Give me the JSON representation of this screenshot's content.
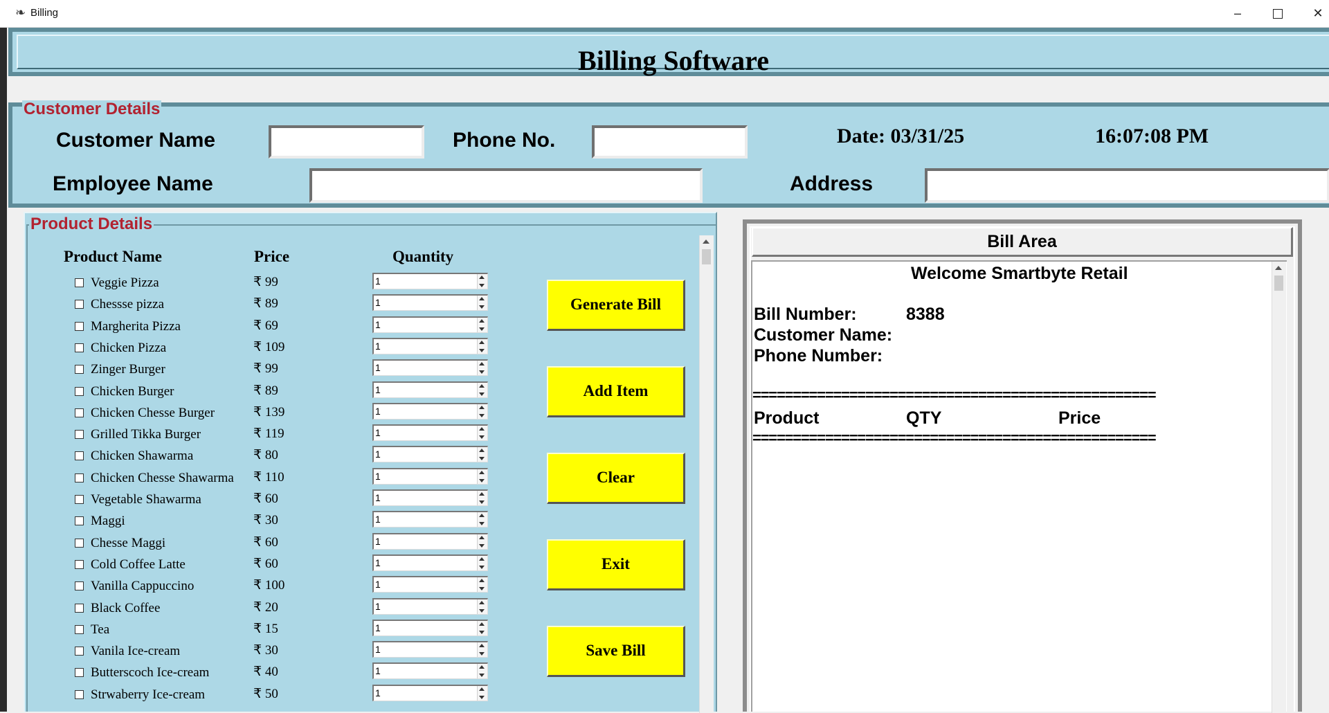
{
  "window": {
    "title": "Billing",
    "minimize_glyph": "–",
    "close_glyph": "✕"
  },
  "header": {
    "title": "Billing Software"
  },
  "customer": {
    "frame_label": "Customer Details",
    "name_label": "Customer Name",
    "name_value": "",
    "phone_label": "Phone No.",
    "phone_value": "",
    "date_label": "Date: 03/31/25",
    "time_label": "16:07:08 PM",
    "employee_label": "Employee Name",
    "employee_value": "",
    "address_label": "Address",
    "address_value": ""
  },
  "products": {
    "frame_label": "Product Details",
    "headers": {
      "name": "Product Name",
      "price": "Price",
      "quantity": "Quantity"
    },
    "items": [
      {
        "name": "Veggie Pizza",
        "price": "₹ 99",
        "qty": "1"
      },
      {
        "name": "Chessse pizza",
        "price": "₹ 89",
        "qty": "1"
      },
      {
        "name": "Margherita Pizza",
        "price": "₹ 69",
        "qty": "1"
      },
      {
        "name": "Chicken Pizza",
        "price": "₹ 109",
        "qty": "1"
      },
      {
        "name": "Zinger Burger",
        "price": "₹ 99",
        "qty": "1"
      },
      {
        "name": "Chicken Burger",
        "price": "₹ 89",
        "qty": "1"
      },
      {
        "name": "Chicken Chesse Burger",
        "price": "₹ 139",
        "qty": "1"
      },
      {
        "name": "Grilled Tikka Burger",
        "price": "₹ 119",
        "qty": "1"
      },
      {
        "name": "Chicken Shawarma",
        "price": "₹ 80",
        "qty": "1"
      },
      {
        "name": "Chicken Chesse Shawarma",
        "price": "₹ 110",
        "qty": "1"
      },
      {
        "name": "Vegetable Shawarma",
        "price": "₹ 60",
        "qty": "1"
      },
      {
        "name": "Maggi",
        "price": "₹ 30",
        "qty": "1"
      },
      {
        "name": "Chesse Maggi",
        "price": "₹ 60",
        "qty": "1"
      },
      {
        "name": "Cold Coffee Latte",
        "price": "₹ 60",
        "qty": "1"
      },
      {
        "name": "Vanilla Cappuccino",
        "price": "₹ 100",
        "qty": "1"
      },
      {
        "name": "Black Coffee",
        "price": "₹ 20",
        "qty": "1"
      },
      {
        "name": "Tea",
        "price": "₹ 15",
        "qty": "1"
      },
      {
        "name": "Vanila Ice-cream",
        "price": "₹ 30",
        "qty": "1"
      },
      {
        "name": "Butterscoch Ice-cream",
        "price": "₹ 40",
        "qty": "1"
      },
      {
        "name": "Strwaberry Ice-cream",
        "price": "₹ 50",
        "qty": "1"
      }
    ]
  },
  "buttons": {
    "generate": "Generate Bill",
    "add": "Add Item",
    "clear": "Clear",
    "exit": "Exit",
    "save": "Save Bill"
  },
  "bill": {
    "area_label": "Bill Area",
    "welcome": "Welcome Smartbyte Retail",
    "bill_number_label": "Bill Number:",
    "bill_number": "8388",
    "customer_name_label": "Customer Name:",
    "phone_number_label": "Phone Number:",
    "separator": "==================================================",
    "col_product": "Product",
    "col_qty": "QTY",
    "col_price": "Price"
  },
  "colors": {
    "panel": "#add8e6",
    "frame_label": "#b22230",
    "button": "#ffff00"
  }
}
